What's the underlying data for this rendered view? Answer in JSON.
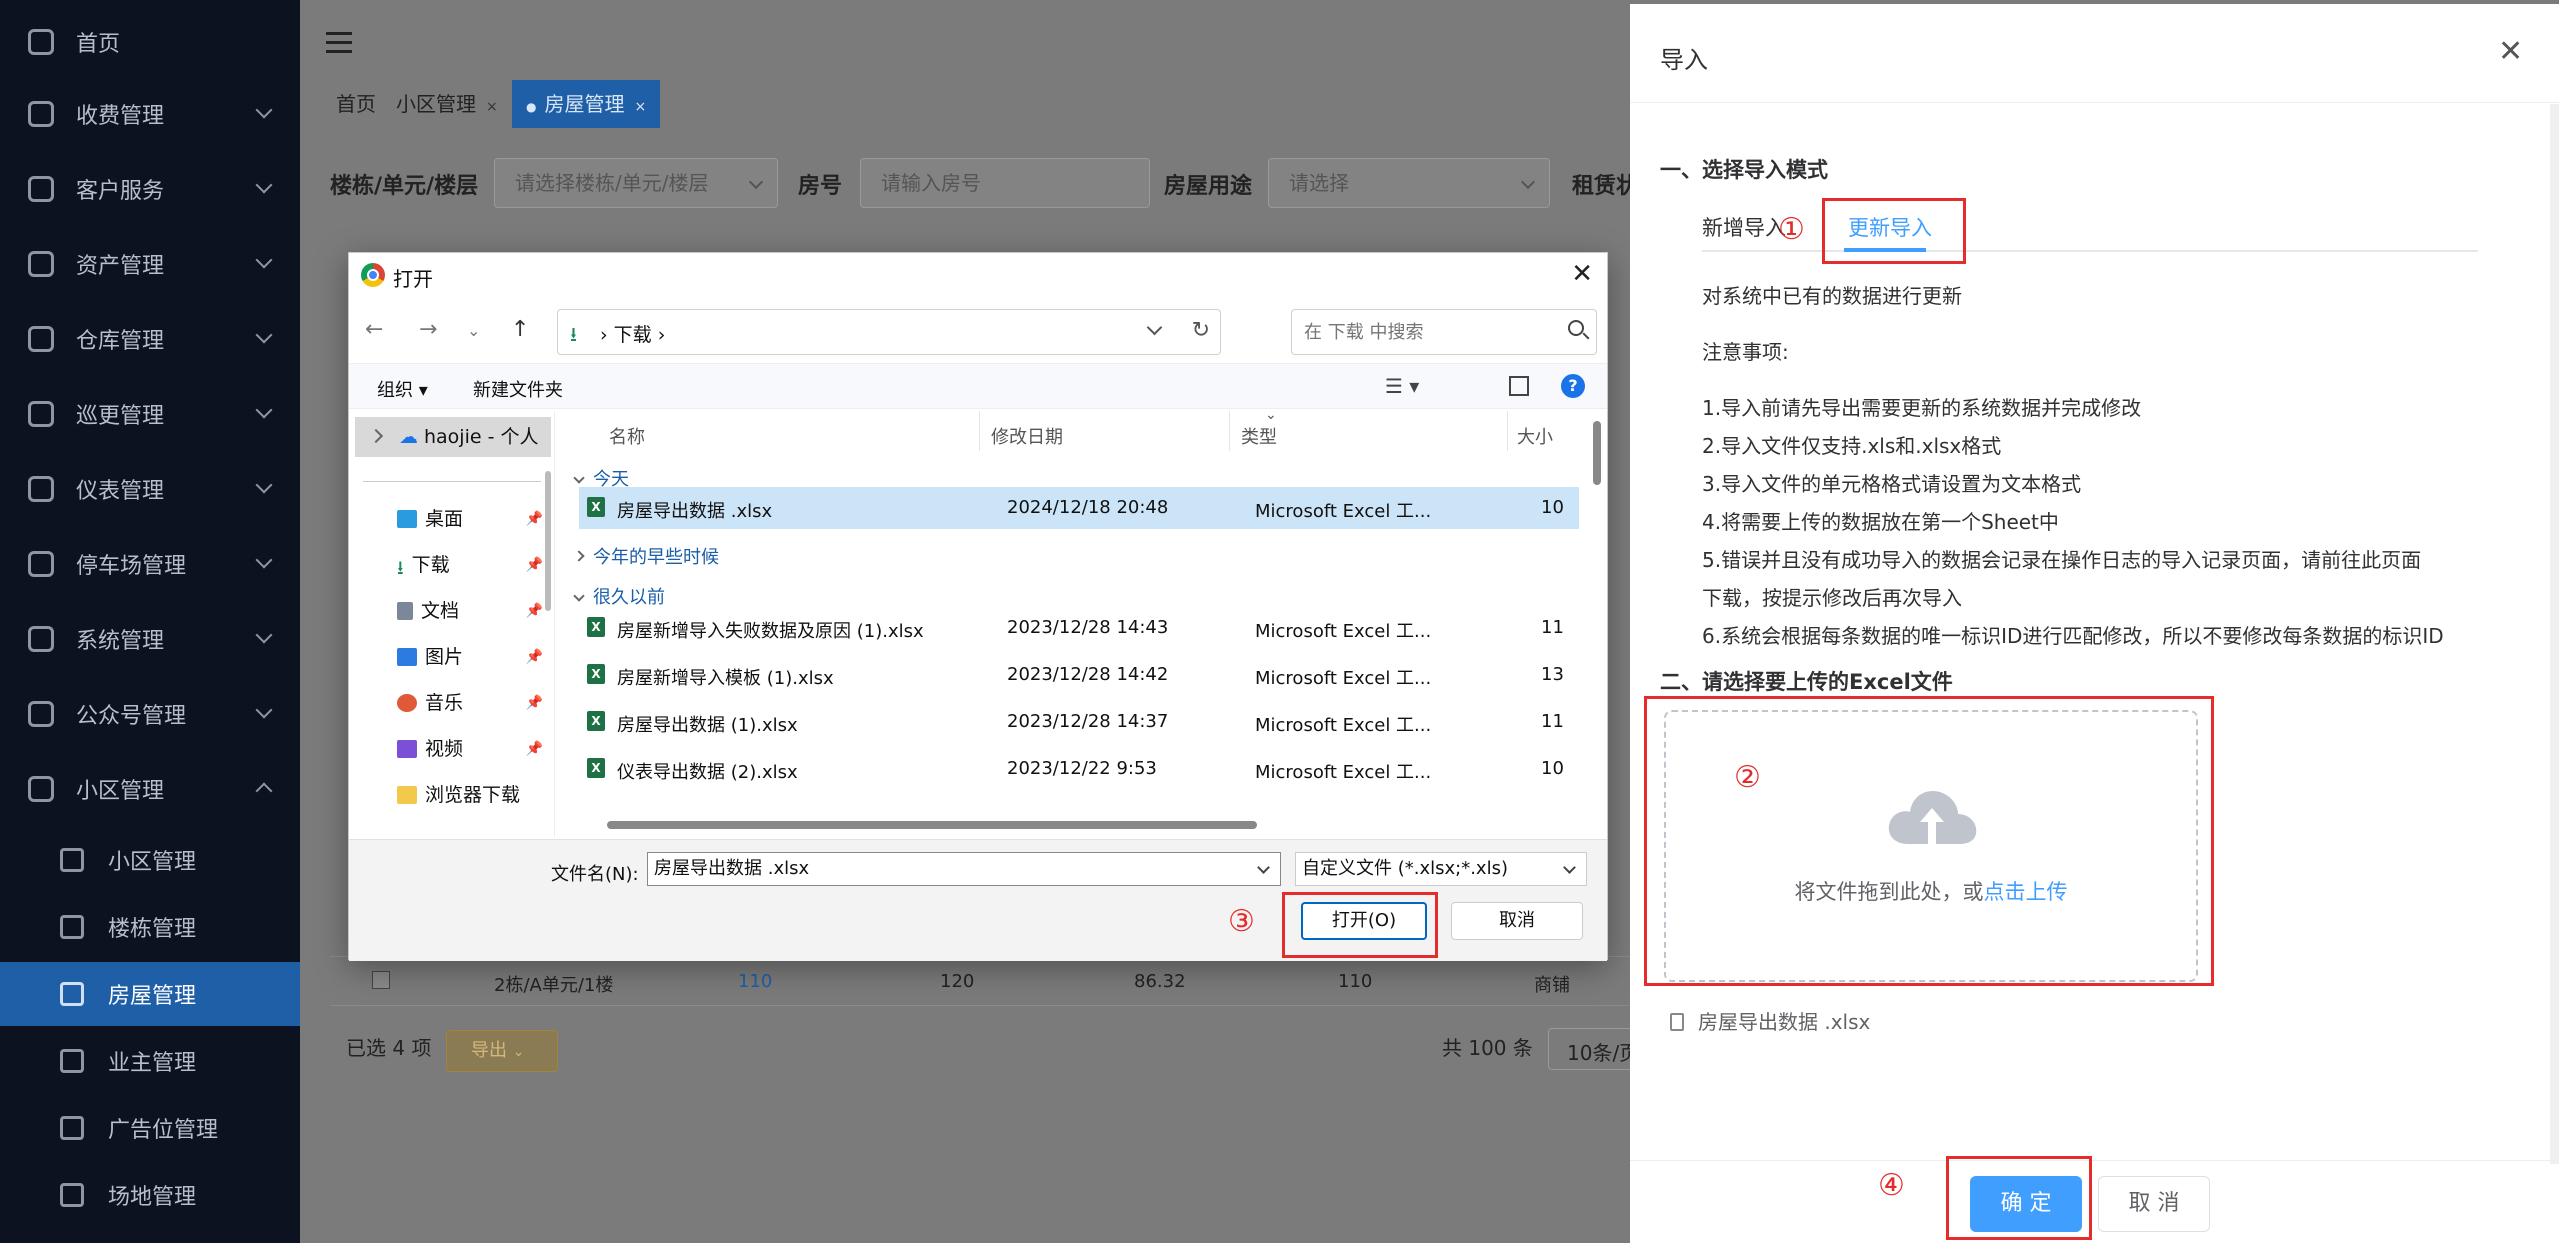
{
  "sidebar": {
    "items": [
      {
        "label": "首页",
        "icon": "dashboard-icon"
      },
      {
        "label": "收费管理",
        "icon": "wallet-icon"
      },
      {
        "label": "客户服务",
        "icon": "user-service-icon"
      },
      {
        "label": "资产管理",
        "icon": "calendar-icon"
      },
      {
        "label": "仓库管理",
        "icon": "layers-icon"
      },
      {
        "label": "巡更管理",
        "icon": "location-icon"
      },
      {
        "label": "仪表管理",
        "icon": "gauge-icon"
      },
      {
        "label": "停车场管理",
        "icon": "parking-icon"
      },
      {
        "label": "系统管理",
        "icon": "gear-icon"
      },
      {
        "label": "公众号管理",
        "icon": "wechat-icon"
      },
      {
        "label": "小区管理",
        "icon": "grid-icon"
      }
    ],
    "sub_items": [
      {
        "label": "小区管理",
        "icon": "globe-icon"
      },
      {
        "label": "楼栋管理",
        "icon": "building-icon"
      },
      {
        "label": "房屋管理",
        "icon": "table-icon",
        "active": true
      },
      {
        "label": "业主管理",
        "icon": "person-icon"
      },
      {
        "label": "广告位管理",
        "icon": "billboard-icon"
      },
      {
        "label": "场地管理",
        "icon": "venue-icon"
      }
    ]
  },
  "main": {
    "tabs": [
      {
        "label": "首页"
      },
      {
        "label": "小区管理"
      },
      {
        "label": "房屋管理"
      }
    ],
    "filters": {
      "building_label": "楼栋/单元/楼层",
      "building_placeholder": "请选择楼栋/单元/楼层",
      "room_label": "房号",
      "room_placeholder": "请输入房号",
      "usage_label": "房屋用途",
      "usage_placeholder": "请选择",
      "lease_label": "租赁状"
    },
    "table_row": [
      "2栋/A单元/1楼",
      "110",
      "120",
      "86.32",
      "110",
      "商铺"
    ],
    "selected_text": "已选 4 项",
    "export_label": "导出",
    "total_text": "共 100 条",
    "page_size": "10条/页"
  },
  "dialog": {
    "title": "打开",
    "path": [
      "下载"
    ],
    "search_placeholder": "在 下载 中搜索",
    "organize": "组织",
    "new_folder": "新建文件夹",
    "nav": {
      "onedrive": "haojie - 个人",
      "quick": [
        {
          "label": "桌面",
          "icon": "desktop-icon",
          "color": "#2b9be0"
        },
        {
          "label": "下载",
          "icon": "download-icon",
          "color": "#1a8a57"
        },
        {
          "label": "文档",
          "icon": "document-icon",
          "color": "#7a8899"
        },
        {
          "label": "图片",
          "icon": "picture-icon",
          "color": "#2b7be0"
        },
        {
          "label": "音乐",
          "icon": "music-icon",
          "color": "#e05a3a"
        },
        {
          "label": "视频",
          "icon": "video-icon",
          "color": "#7b4fd6"
        },
        {
          "label": "浏览器下载",
          "icon": "folder-icon",
          "color": "#f2c94c"
        }
      ]
    },
    "columns": [
      "名称",
      "修改日期",
      "类型",
      "大小"
    ],
    "groups": {
      "today": "今天",
      "earlier_this_year": "今年的早些时候",
      "long_ago": "很久以前"
    },
    "files": [
      {
        "name": "房屋导出数据 .xlsx",
        "date": "2024/12/18 20:48",
        "type": "Microsoft Excel 工...",
        "size": "10",
        "selected": true
      },
      {
        "name": "房屋新增导入失败数据及原因 (1).xlsx",
        "date": "2023/12/28 14:43",
        "type": "Microsoft Excel 工...",
        "size": "11"
      },
      {
        "name": "房屋新增导入模板 (1).xlsx",
        "date": "2023/12/28 14:42",
        "type": "Microsoft Excel 工...",
        "size": "13"
      },
      {
        "name": "房屋导出数据 (1).xlsx",
        "date": "2023/12/28 14:37",
        "type": "Microsoft Excel 工...",
        "size": "11"
      },
      {
        "name": "仪表导出数据 (2).xlsx",
        "date": "2023/12/22 9:53",
        "type": "Microsoft Excel 工...",
        "size": "10"
      }
    ],
    "filename_label": "文件名(N):",
    "filename_value": "房屋导出数据 .xlsx",
    "filetype_value": "自定义文件 (*.xlsx;*.xls)",
    "open_label": "打开(O)",
    "cancel_label": "取消"
  },
  "panel": {
    "title": "导入",
    "section1": "一、选择导入模式",
    "tab_add": "新增导入",
    "tab_update": "更新导入",
    "desc": "对系统中已有的数据进行更新",
    "notes_title": "注意事项:",
    "notes": [
      "1.导入前请先导出需要更新的系统数据并完成修改",
      "2.导入文件仅支持.xls和.xlsx格式",
      "3.导入文件的单元格格式请设置为文本格式",
      "4.将需要上传的数据放在第一个Sheet中",
      "5.错误并且没有成功导入的数据会记录在操作日志的导入记录页面，请前往此页面",
      "下载，按提示修改后再次导入",
      "6.系统会根据每条数据的唯一标识ID进行匹配修改，所以不要修改每条数据的标识ID"
    ],
    "section2": "二、请选择要上传的Excel文件",
    "upload_text": "将文件拖到此处，或",
    "upload_link": "点击上传",
    "uploaded_file": "房屋导出数据 .xlsx",
    "ok_label": "确 定",
    "cancel_label": "取 消"
  },
  "annotations": {
    "n1": "①",
    "n2": "②",
    "n3": "③",
    "n4": "④",
    "color": "#e52b2b"
  },
  "colors": {
    "sidebar_bg": "#0c1220",
    "active_blue": "#1f5fa8",
    "primary": "#409eff"
  }
}
